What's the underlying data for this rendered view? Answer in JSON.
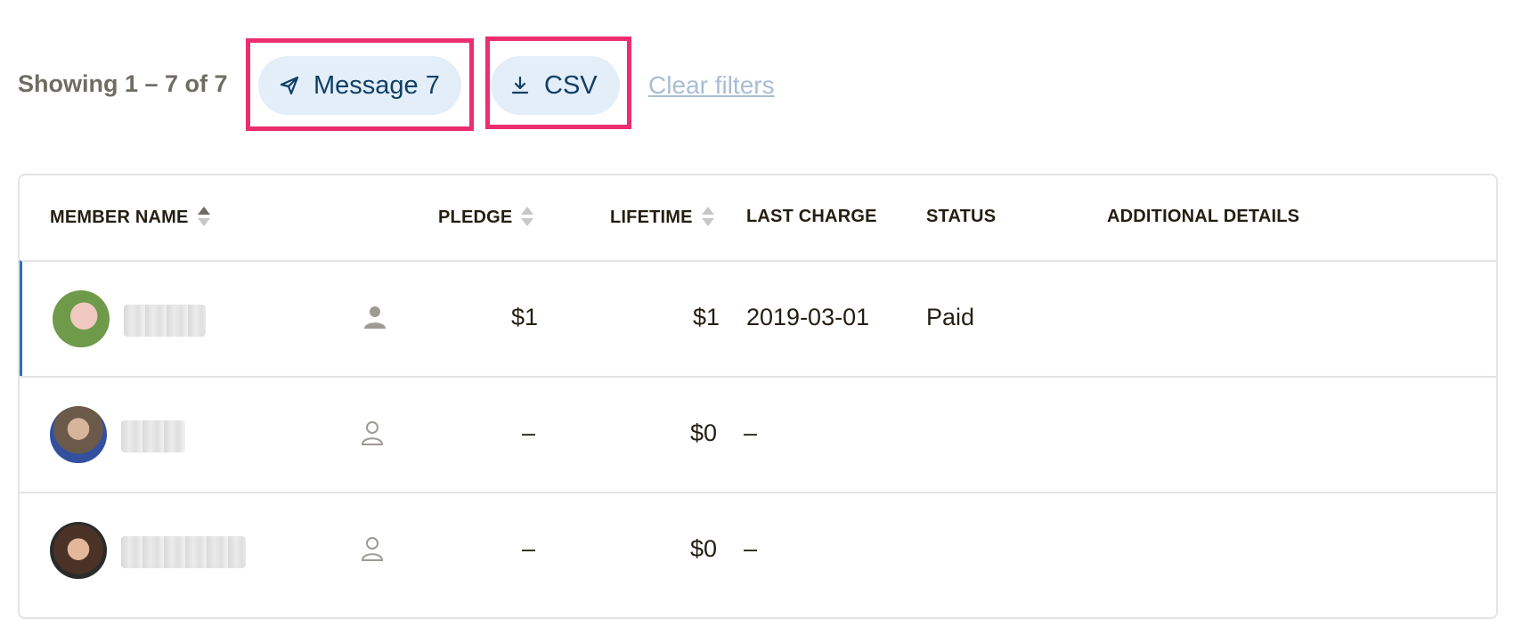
{
  "toolbar": {
    "showing": "Showing 1 – 7 of 7",
    "message_label": "Message 7",
    "message_icon": "send-icon",
    "csv_label": "CSV",
    "csv_icon": "download-icon",
    "clear_filters": "Clear filters",
    "highlight_color": "#ec2e6e",
    "accent_color": "#0f3f66"
  },
  "table": {
    "columns": [
      "MEMBER NAME",
      "PLEDGE",
      "LIFETIME",
      "LAST CHARGE",
      "STATUS",
      "ADDITIONAL DETAILS"
    ],
    "rows": [
      {
        "pledge": "$1",
        "lifetime": "$1",
        "last_charge": "2019-03-01",
        "status": "Paid",
        "patron_icon": "person-filled-icon"
      },
      {
        "pledge": "–",
        "lifetime": "$0",
        "last_charge": "–",
        "status": "",
        "patron_icon": "person-outline-icon"
      },
      {
        "pledge": "–",
        "lifetime": "$0",
        "last_charge": "–",
        "status": "",
        "patron_icon": "person-outline-icon"
      }
    ]
  }
}
